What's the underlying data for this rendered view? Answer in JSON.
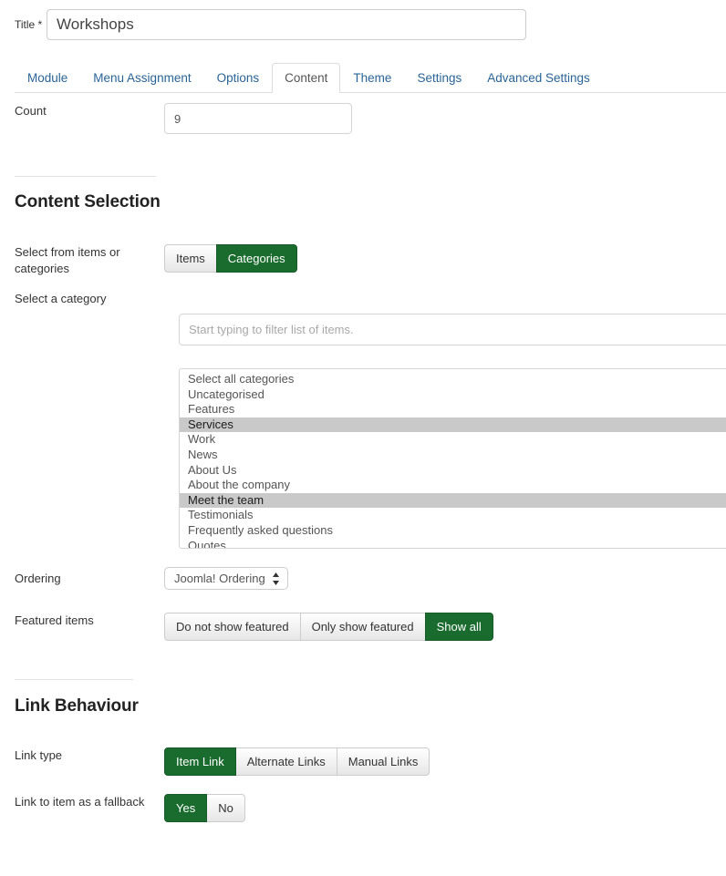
{
  "title_field": {
    "label": "Title *",
    "value": "Workshops",
    "placeholder": ""
  },
  "tabs": [
    {
      "label": "Module",
      "active": false
    },
    {
      "label": "Menu Assignment",
      "active": false
    },
    {
      "label": "Options",
      "active": false
    },
    {
      "label": "Content",
      "active": true
    },
    {
      "label": "Theme",
      "active": false
    },
    {
      "label": "Settings",
      "active": false
    },
    {
      "label": "Advanced Settings",
      "active": false
    }
  ],
  "count_field": {
    "label": "Count",
    "value": "9"
  },
  "content_selection": {
    "heading": "Content Selection",
    "source_label": "Select from items or categories",
    "source_options": [
      {
        "label": "Items",
        "active": false
      },
      {
        "label": "Categories",
        "active": true
      }
    ],
    "category_label": "Select a category",
    "filter_placeholder": "Start typing to filter list of items.",
    "filter_value": "",
    "categories": [
      {
        "label": "Select all categories",
        "selected": false
      },
      {
        "label": "Uncategorised",
        "selected": false
      },
      {
        "label": "Features",
        "selected": false
      },
      {
        "label": "Services",
        "selected": true
      },
      {
        "label": "Work",
        "selected": false
      },
      {
        "label": "News",
        "selected": false
      },
      {
        "label": "About Us",
        "selected": false
      },
      {
        "label": "About the company",
        "selected": false
      },
      {
        "label": "Meet the team",
        "selected": true
      },
      {
        "label": "Testimonials",
        "selected": false
      },
      {
        "label": "Frequently asked questions",
        "selected": false
      },
      {
        "label": "Quotes",
        "selected": false
      }
    ],
    "ordering_label": "Ordering",
    "ordering_value": "Joomla! Ordering",
    "featured_label": "Featured items",
    "featured_options": [
      {
        "label": "Do not show featured",
        "active": false
      },
      {
        "label": "Only show featured",
        "active": false
      },
      {
        "label": "Show all",
        "active": true
      }
    ]
  },
  "link_behaviour": {
    "heading": "Link Behaviour",
    "link_type_label": "Link type",
    "link_type_options": [
      {
        "label": "Item Link",
        "active": true
      },
      {
        "label": "Alternate Links",
        "active": false
      },
      {
        "label": "Manual Links",
        "active": false
      }
    ],
    "fallback_label": "Link to item as a fallback",
    "fallback_options": [
      {
        "label": "Yes",
        "active": true
      },
      {
        "label": "No",
        "active": false
      }
    ]
  },
  "colors": {
    "accent_green": "#1a6b2e",
    "link_blue": "#2a6496",
    "selected_row": "#c9c9c9"
  }
}
